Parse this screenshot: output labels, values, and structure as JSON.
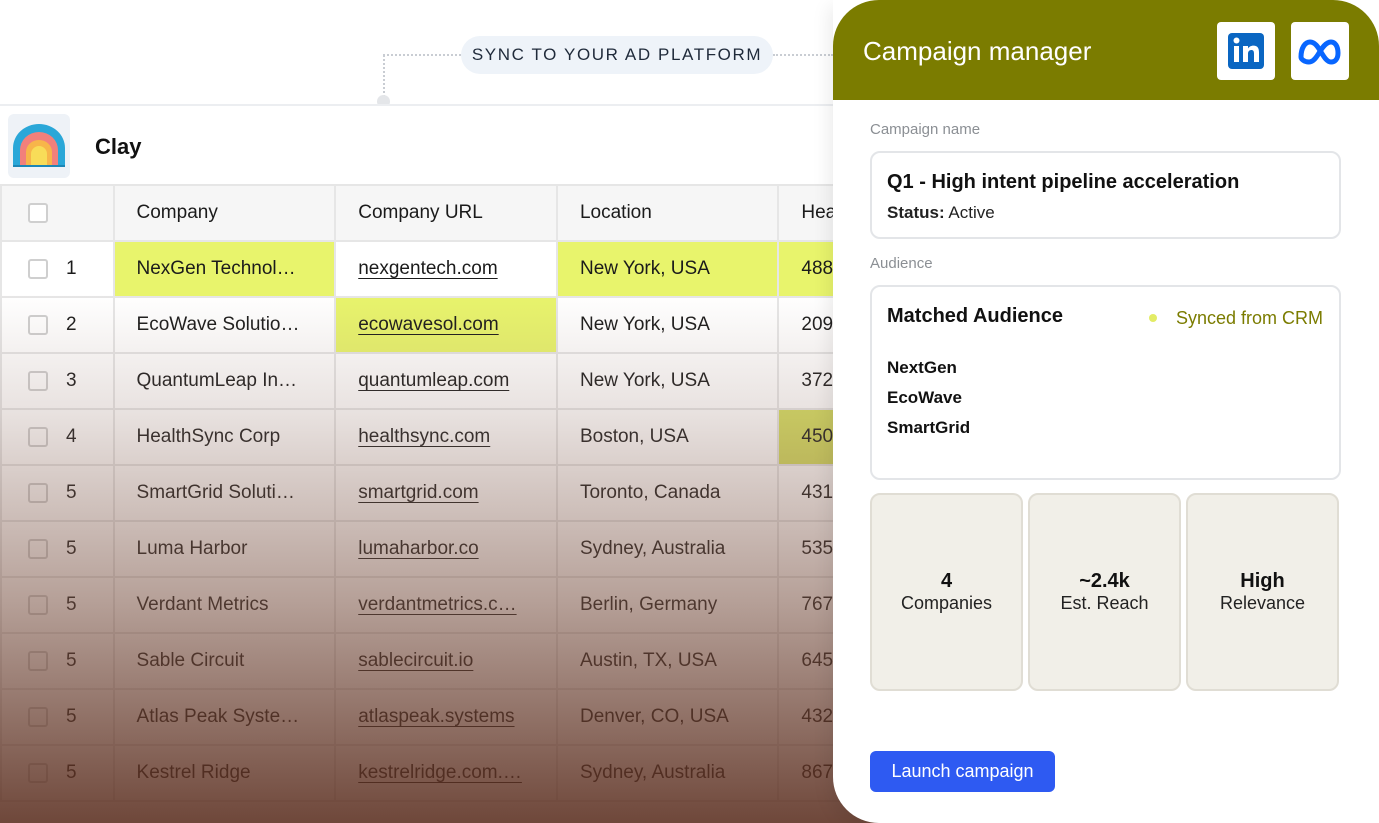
{
  "sync_label": "SYNC TO YOUR AD PLATFORM",
  "clay": {
    "name": "Clay"
  },
  "table": {
    "columns": [
      "Company",
      "Company URL",
      "Location",
      "Hea"
    ],
    "rows": [
      {
        "num": "1",
        "company": "NexGen Technol…",
        "url": "nexgentech.com",
        "location": "New York, USA",
        "extra": "488"
      },
      {
        "num": "2",
        "company": "EcoWave Solutio…",
        "url": "ecowavesol.com",
        "location": "New York, USA",
        "extra": "209"
      },
      {
        "num": "3",
        "company": "QuantumLeap In…",
        "url": "quantumleap.com",
        "location": "New York, USA",
        "extra": "372"
      },
      {
        "num": "4",
        "company": "HealthSync Corp",
        "url": "healthsync.com",
        "location": "Boston, USA",
        "extra": "450"
      },
      {
        "num": "5",
        "company": "SmartGrid Soluti…",
        "url": "smartgrid.com",
        "location": "Toronto, Canada",
        "extra": "431"
      },
      {
        "num": "5",
        "company": "Luma Harbor",
        "url": "lumaharbor.co",
        "location": "Sydney, Australia",
        "extra": "535"
      },
      {
        "num": "5",
        "company": "Verdant Metrics",
        "url": "verdantmetrics.c…",
        "location": "Berlin, Germany",
        "extra": "767"
      },
      {
        "num": "5",
        "company": "Sable Circuit",
        "url": "sablecircuit.io",
        "location": "Austin, TX, USA",
        "extra": "645"
      },
      {
        "num": "5",
        "company": "Atlas Peak Syste…",
        "url": "atlaspeak.systems",
        "location": "Denver, CO, USA",
        "extra": "432"
      },
      {
        "num": "5",
        "company": "Kestrel Ridge",
        "url": "kestrelridge.com.…",
        "location": "Sydney, Australia",
        "extra": "867"
      }
    ]
  },
  "panel": {
    "title": "Campaign manager",
    "platform_icons": [
      "linkedin-icon",
      "meta-icon"
    ],
    "campaign_name_label": "Campaign name",
    "campaign_name": "Q1 - High intent pipeline acceleration",
    "status_label": "Status:",
    "status_value": "Active",
    "audience_label": "Audience",
    "audience_title": "Matched Audience",
    "audience_source": "Synced from CRM",
    "audience_items": [
      "NextGen",
      "EcoWave",
      "SmartGrid"
    ],
    "stats": [
      {
        "value": "4",
        "label": "Companies"
      },
      {
        "value": "~2.4k",
        "label": "Est. Reach"
      },
      {
        "value": "High",
        "label": "Relevance"
      }
    ],
    "launch_label": "Launch campaign"
  },
  "colors": {
    "brand_olive": "#7b7c00",
    "highlight": "#e8f46c",
    "launch_blue": "#2e5af2",
    "linkedin_blue": "#0a66c2",
    "meta_blue": "#0866ff"
  }
}
